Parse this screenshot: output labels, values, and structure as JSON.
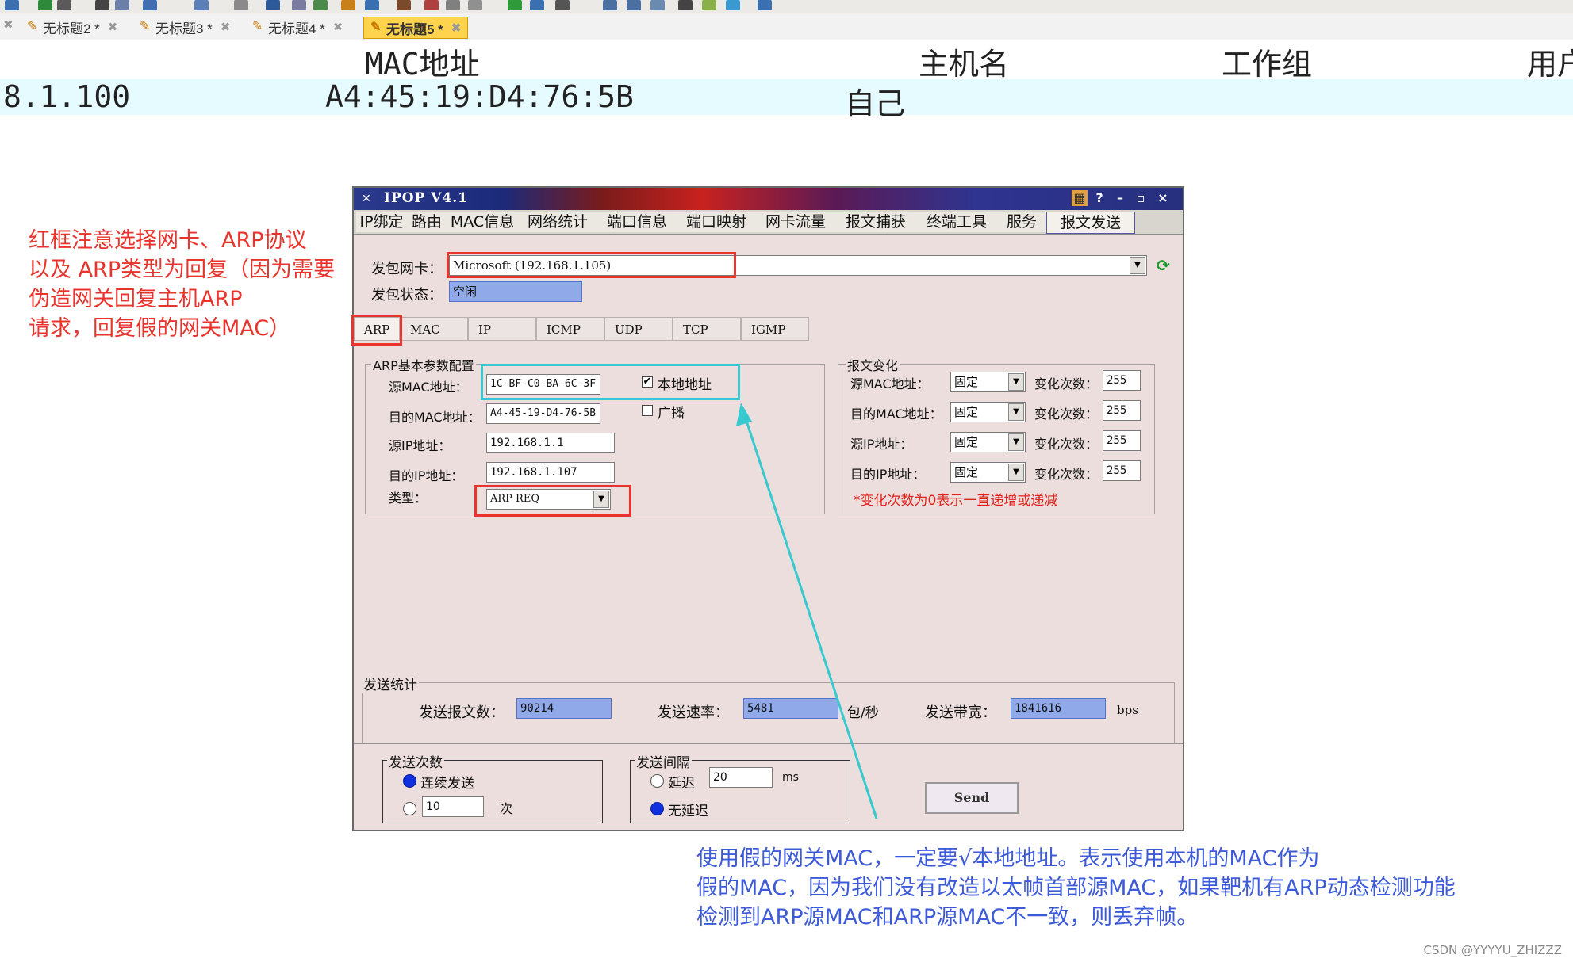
{
  "editor": {
    "tabs": [
      {
        "label": "无标题2 *",
        "active": false
      },
      {
        "label": "无标题3 *",
        "active": false
      },
      {
        "label": "无标题4 *",
        "active": false
      },
      {
        "label": "无标题5 *",
        "active": true
      }
    ]
  },
  "table": {
    "headers": [
      "MAC地址",
      "主机名",
      "工作组",
      "用户"
    ],
    "row": {
      "ip": "8.1.100",
      "mac": "A4:45:19:D4:76:5B",
      "host": "自己"
    }
  },
  "annotation_red": [
    "红框注意选择网卡、ARP协议",
    "以及 ARP类型为回复（因为需要",
    "伪造网关回复主机ARP",
    "请求，回复假的网关MAC）"
  ],
  "annotation_blue": [
    "使用假的网关MAC，一定要√本地地址。表示使用本机的MAC作为",
    "假的MAC，因为我们没有改造以太帧首部源MAC，如果靶机有ARP动态检测功能",
    "检测到ARP源MAC和ARP源MAC不一致，则丢弃帧。"
  ],
  "credit": "CSDN @YYYYU_ZHIZZZ",
  "ipop": {
    "title": "IPOP V4.1",
    "menu": [
      "IP绑定",
      "路由",
      "MAC信息",
      "网络统计",
      "端口信息",
      "端口映射",
      "网卡流量",
      "报文捕获",
      "终端工具",
      "服务",
      "报文发送"
    ],
    "active_menu": "报文发送",
    "nic_label": "发包网卡：",
    "nic_value": "Microsoft (192.168.1.105)",
    "status_label": "发包状态：",
    "status_value": "空闲",
    "proto_tabs": [
      "ARP",
      "MAC",
      "IP",
      "ICMP",
      "UDP",
      "TCP",
      "IGMP"
    ],
    "arp": {
      "group_title": "ARP基本参数配置",
      "src_mac_label": "源MAC地址：",
      "src_mac": "1C-BF-C0-BA-6C-3F",
      "local_addr_label": "本地地址",
      "dst_mac_label": "目的MAC地址：",
      "dst_mac": "A4-45-19-D4-76-5B",
      "broadcast_label": "广播",
      "src_ip_label": "源IP地址：",
      "src_ip": "192.168.1.1",
      "dst_ip_label": "目的IP地址：",
      "dst_ip": "192.168.1.107",
      "type_label": "类型：",
      "type_value": "ARP  REQ"
    },
    "change": {
      "group_title": "报文变化",
      "rows": [
        {
          "label": "源MAC地址：",
          "mode": "固定",
          "count_label": "变化次数：",
          "count": "255"
        },
        {
          "label": "目的MAC地址：",
          "mode": "固定",
          "count_label": "变化次数：",
          "count": "255"
        },
        {
          "label": "源IP地址：",
          "mode": "固定",
          "count_label": "变化次数：",
          "count": "255"
        },
        {
          "label": "目的IP地址：",
          "mode": "固定",
          "count_label": "变化次数：",
          "count": "255"
        }
      ],
      "note": "*变化次数为0表示一直递增或递减"
    },
    "stats": {
      "group_title": "发送统计",
      "packets_label": "发送报文数：",
      "packets": "90214",
      "rate_label": "发送速率：",
      "rate": "5481",
      "rate_unit": "包/秒",
      "bw_label": "发送带宽：",
      "bw": "1841616",
      "bw_unit": "bps"
    },
    "send_count": {
      "group_title": "发送次数",
      "continuous_label": "连续发送",
      "count_value": "10",
      "count_unit": "次"
    },
    "send_interval": {
      "group_title": "发送间隔",
      "delay_label": "延迟",
      "delay_value": "20",
      "delay_unit": "ms",
      "nodelay_label": "无延迟"
    },
    "send_button": "Send"
  }
}
